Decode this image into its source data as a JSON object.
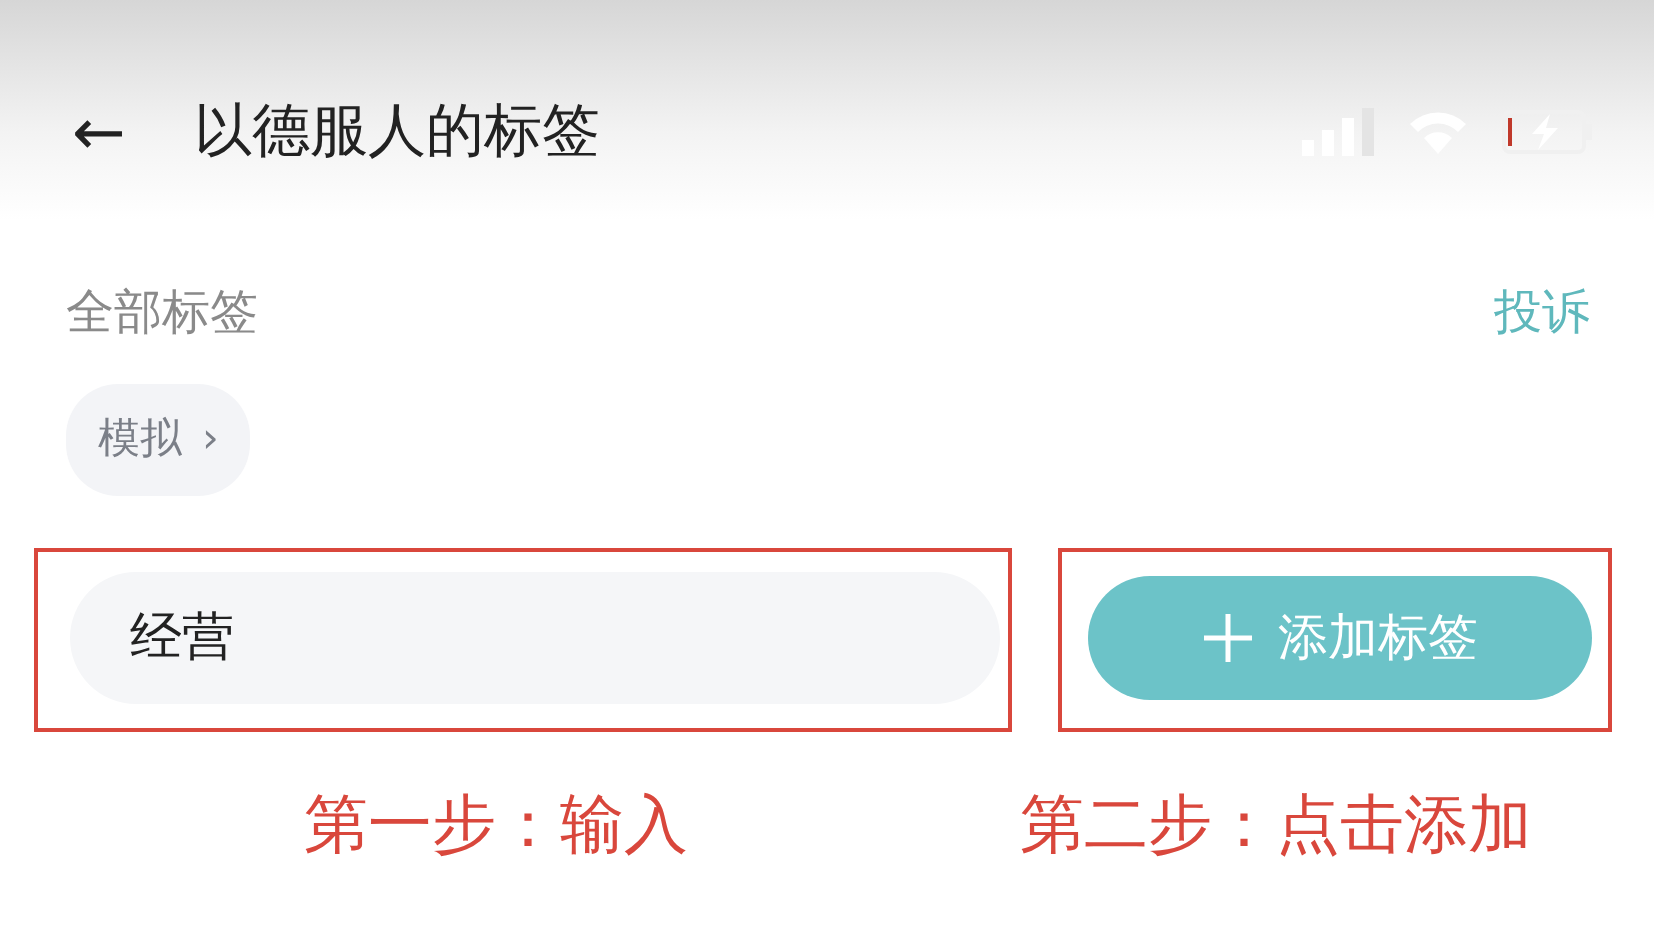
{
  "header": {
    "back": "←",
    "title": "以德服人的标签"
  },
  "section": {
    "label": "全部标签",
    "action": "投诉"
  },
  "tags": [
    {
      "label": "模拟",
      "chevron": "›"
    }
  ],
  "tag_input": {
    "value": "经营"
  },
  "add_button": {
    "label": "添加标签"
  },
  "annotations": [
    {
      "text": "第一步：输入"
    },
    {
      "text": "第二步：点击添加"
    }
  ]
}
